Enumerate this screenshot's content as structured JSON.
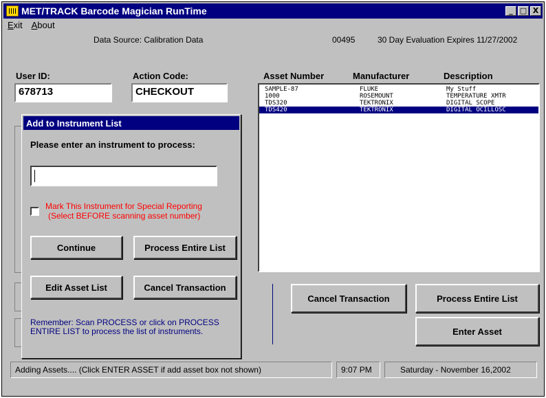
{
  "window": {
    "title": "MET/TRACK Barcode Magician RunTime",
    "controls": [
      "_",
      "□",
      "X"
    ]
  },
  "menu": {
    "exit": "Exit",
    "about": "About"
  },
  "info": {
    "data_source": "Data Source:  Calibration Data",
    "code": "00495",
    "evaluation": "30 Day Evaluation Expires 11/27/2002"
  },
  "fields": {
    "user_id_label": "User ID:",
    "user_id_value": "678713",
    "action_code_label": "Action Code:",
    "action_code_value": "CHECKOUT"
  },
  "asset_list": {
    "headers": [
      "Asset Number",
      "Manufacturer",
      "Description"
    ],
    "rows": [
      {
        "asset": "SAMPLE-87",
        "manufacturer": "FLUKE",
        "description": "My Stuff"
      },
      {
        "asset": "1000",
        "manufacturer": "ROSEMOUNT",
        "description": "TEMPERATURE XMTR"
      },
      {
        "asset": "TDS320",
        "manufacturer": "TEKTRONIX",
        "description": "DIGITAL SCOPE"
      },
      {
        "asset": "TDS420",
        "manufacturer": "TEKTRONIX",
        "description": "DIGITAL OCILLOSC"
      }
    ],
    "selected_index": 3
  },
  "main_buttons": {
    "cancel": "Cancel Transaction",
    "process": "Process Entire List",
    "enter_asset": "Enter Asset"
  },
  "status": {
    "message": "Adding Assets.... (Click ENTER ASSET if add asset box not shown)",
    "time": "9:07 PM",
    "date": "Saturday - November 16,2002"
  },
  "dialog": {
    "title": "Add to Instrument List",
    "prompt": "Please enter an instrument to process:",
    "input_value": "",
    "checkbox_line1": "Mark This Instrument for Special Reporting",
    "checkbox_line2": "(Select BEFORE scanning asset number)",
    "checkbox_checked": false,
    "continue": "Continue",
    "process": "Process Entire List",
    "edit": "Edit Asset List",
    "cancel": "Cancel Transaction",
    "note": "Remember: Scan PROCESS  or click on PROCESS ENTIRE LIST to process the list of instruments."
  },
  "colors": {
    "titlebar": "#000080",
    "face": "#c0c0c0",
    "selection": "#000080",
    "warning_text": "#ff0000",
    "note_text": "#000080"
  }
}
